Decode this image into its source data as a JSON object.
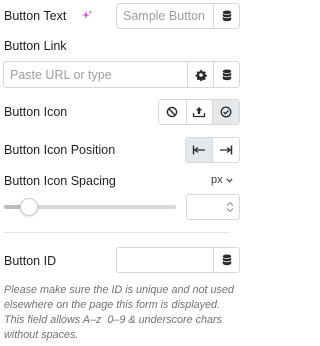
{
  "button_text": {
    "label": "Button Text",
    "placeholder": "Sample Button",
    "ai_icon": "sparkle-icon",
    "dynamic_icon": "database-icon"
  },
  "button_link": {
    "label": "Button Link",
    "placeholder": "Paste URL or type",
    "settings_icon": "gear-icon",
    "dynamic_icon": "database-icon"
  },
  "button_icon": {
    "label": "Button Icon",
    "options": [
      {
        "icon": "none-icon"
      },
      {
        "icon": "upload-icon"
      },
      {
        "icon": "check-circle-icon",
        "selected": true
      }
    ]
  },
  "button_icon_position": {
    "label": "Button Icon Position",
    "options": [
      {
        "icon": "align-start-icon",
        "selected": true
      },
      {
        "icon": "align-end-icon"
      }
    ]
  },
  "button_icon_spacing": {
    "label": "Button Icon Spacing",
    "unit": "px",
    "slider_level": 0.1
  },
  "button_id": {
    "label": "Button ID",
    "dynamic_icon": "database-icon",
    "help_lines": [
      "Please make sure the ID is unique and not used",
      "elsewhere on the page this form is displayed.",
      "This field allows A–z  0–9 & underscore chars",
      "without spaces."
    ]
  },
  "colors": {
    "accent_pink": "#d44fd2",
    "border": "#d5d8dc",
    "active_bg": "#e6e9ec"
  }
}
